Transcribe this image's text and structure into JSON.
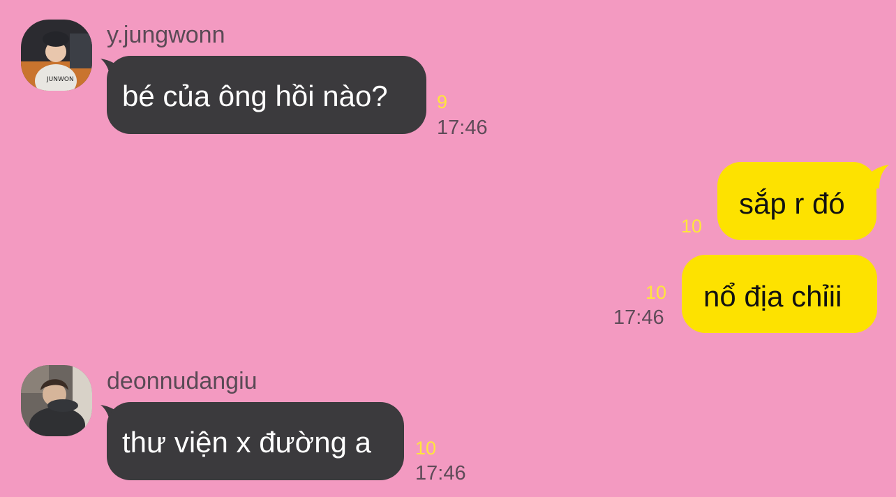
{
  "colors": {
    "background": "#f39ac1",
    "incoming_bubble": "#3b3a3d",
    "outgoing_bubble": "#fde200",
    "unread_count": "#ffe63b"
  },
  "messages": [
    {
      "sender": "y.jungwonn",
      "text": "bé của ông hồi nào?",
      "unread": "9",
      "time": "17:46"
    },
    {
      "text": "sắp r đó",
      "unread": "10"
    },
    {
      "text": "nổ địa chỉii",
      "unread": "10",
      "time": "17:46"
    },
    {
      "sender": "deonnudangiu",
      "text": "thư viện x đường a",
      "unread": "10",
      "time": "17:46"
    }
  ]
}
